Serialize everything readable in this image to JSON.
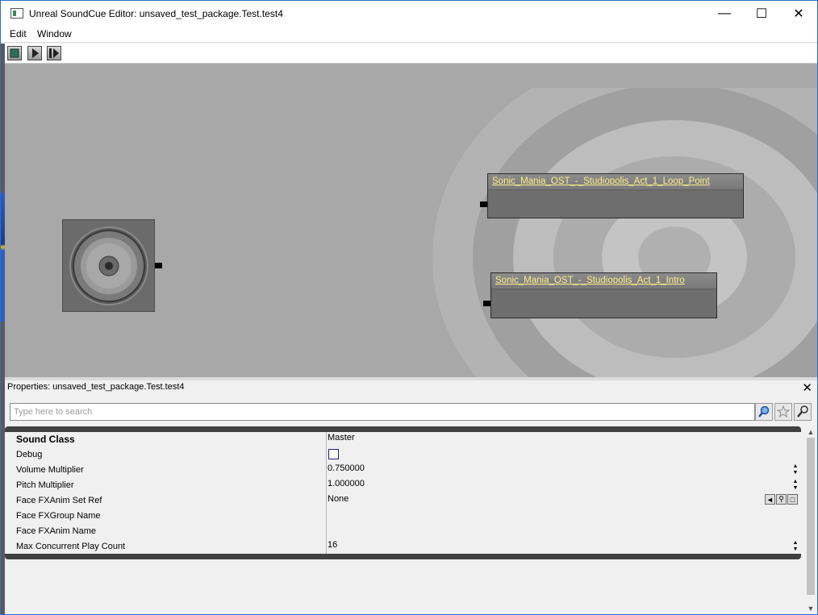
{
  "window": {
    "title": "Unreal SoundCue Editor: unsaved_test_package.Test.test4",
    "minimize_glyph": "—",
    "maximize_glyph": "☐",
    "close_glyph": "✕"
  },
  "menu": {
    "items": [
      {
        "label": "Edit"
      },
      {
        "label": "Window"
      }
    ]
  },
  "toolbar": {
    "buttons": [
      {
        "icon": "stop-icon"
      },
      {
        "icon": "play-icon"
      },
      {
        "icon": "play-node-icon"
      }
    ]
  },
  "canvas": {
    "output_node": {
      "icon": "speaker-icon"
    },
    "wave_nodes": [
      {
        "label": "Sonic_Mania_OST_-_Studiopolis_Act_1_Loop_Point"
      },
      {
        "label": "Sonic_Mania_OST_-_Studiopolis_Act_1_Intro"
      }
    ],
    "wave_title_color": "#ffee88"
  },
  "properties": {
    "title": "Properties: unsaved_test_package.Test.test4",
    "close_glyph": "✕",
    "search_placeholder": "Type here to search",
    "search_value": "",
    "rows": [
      {
        "name": "Sound Class",
        "value": "Master",
        "bold": true
      },
      {
        "name": "Debug",
        "value": "",
        "checkbox": true,
        "checked": false
      },
      {
        "name": "Volume Multiplier",
        "value": "0.750000",
        "spinner": true
      },
      {
        "name": "Pitch Multiplier",
        "value": "1.000000",
        "spinner": true
      },
      {
        "name": "Face FXAnim Set Ref",
        "value": "None",
        "ref_buttons": true
      },
      {
        "name": "Face FXGroup Name",
        "value": ""
      },
      {
        "name": "Face FXAnim Name",
        "value": ""
      },
      {
        "name": "Max Concurrent Play Count",
        "value": "16",
        "spinner": true
      }
    ]
  }
}
